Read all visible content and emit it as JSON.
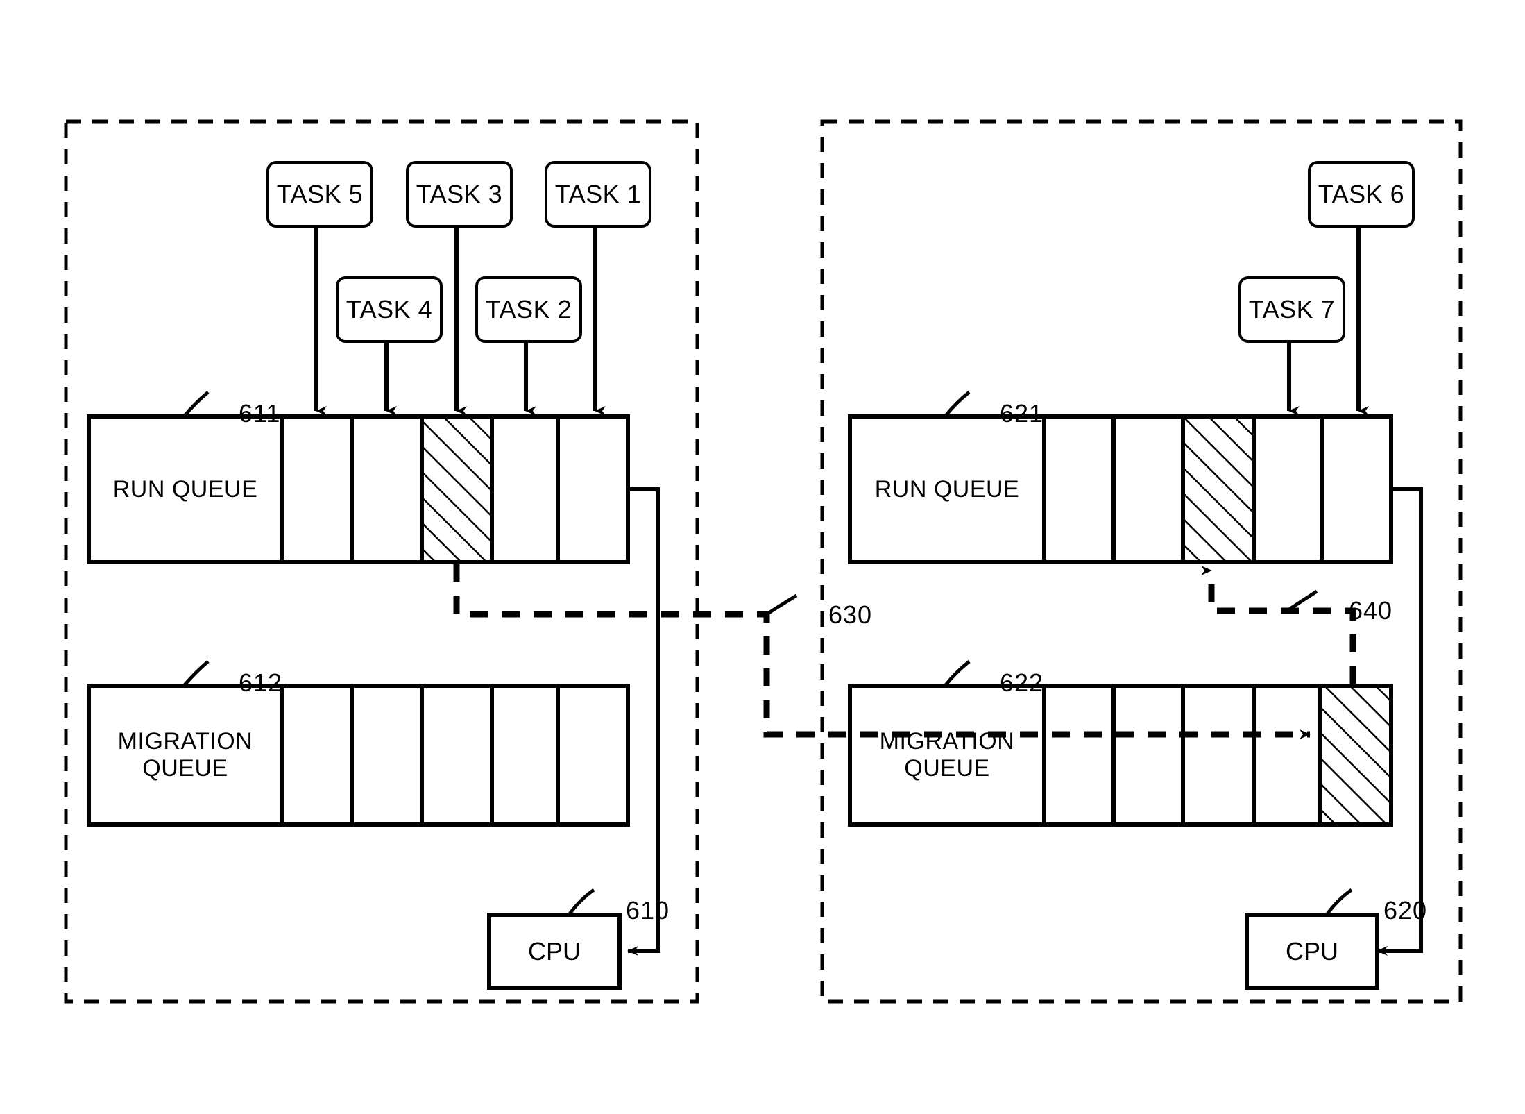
{
  "figure": {
    "type": "patent-diagram",
    "description": "Two CPU domains each with a run queue and a migration queue, showing task migration paths"
  },
  "panels": [
    {
      "id": "left",
      "cpu": {
        "label": "CPU",
        "ref": "610"
      },
      "run_queue": {
        "ref": "611",
        "label_line1": "RUN QUEUE",
        "label_line2": "",
        "cells": 6,
        "hatched_index": 3
      },
      "migration_queue": {
        "ref": "612",
        "label_line1": "MIGRATION",
        "label_line2": "QUEUE",
        "cells": 6,
        "hatched_index": -1
      },
      "tasks": [
        {
          "label": "TASK 5",
          "row": "top"
        },
        {
          "label": "TASK 4",
          "row": "bottom"
        },
        {
          "label": "TASK 3",
          "row": "top"
        },
        {
          "label": "TASK 2",
          "row": "bottom"
        },
        {
          "label": "TASK 1",
          "row": "top"
        }
      ]
    },
    {
      "id": "right",
      "cpu": {
        "label": "CPU",
        "ref": "620"
      },
      "run_queue": {
        "ref": "621",
        "label_line1": "RUN QUEUE",
        "label_line2": "",
        "cells": 6,
        "hatched_index": 3
      },
      "migration_queue": {
        "ref": "622",
        "label_line1": "MIGRATION",
        "label_line2": "QUEUE",
        "cells": 6,
        "hatched_index": 5
      },
      "tasks": [
        {
          "label": "TASK 7",
          "row": "bottom"
        },
        {
          "label": "TASK 6",
          "row": "top"
        }
      ]
    }
  ],
  "flows": [
    {
      "ref": "630",
      "style": "dashed",
      "from": "left-run-queue-hatched-cell",
      "to": "right-migration-queue-hatched-cell"
    },
    {
      "ref": "640",
      "style": "dashed",
      "from": "right-migration-queue-hatched-cell",
      "to": "right-run-queue-hatched-cell"
    }
  ],
  "colors": {
    "line": "#000000",
    "background": "#ffffff"
  }
}
